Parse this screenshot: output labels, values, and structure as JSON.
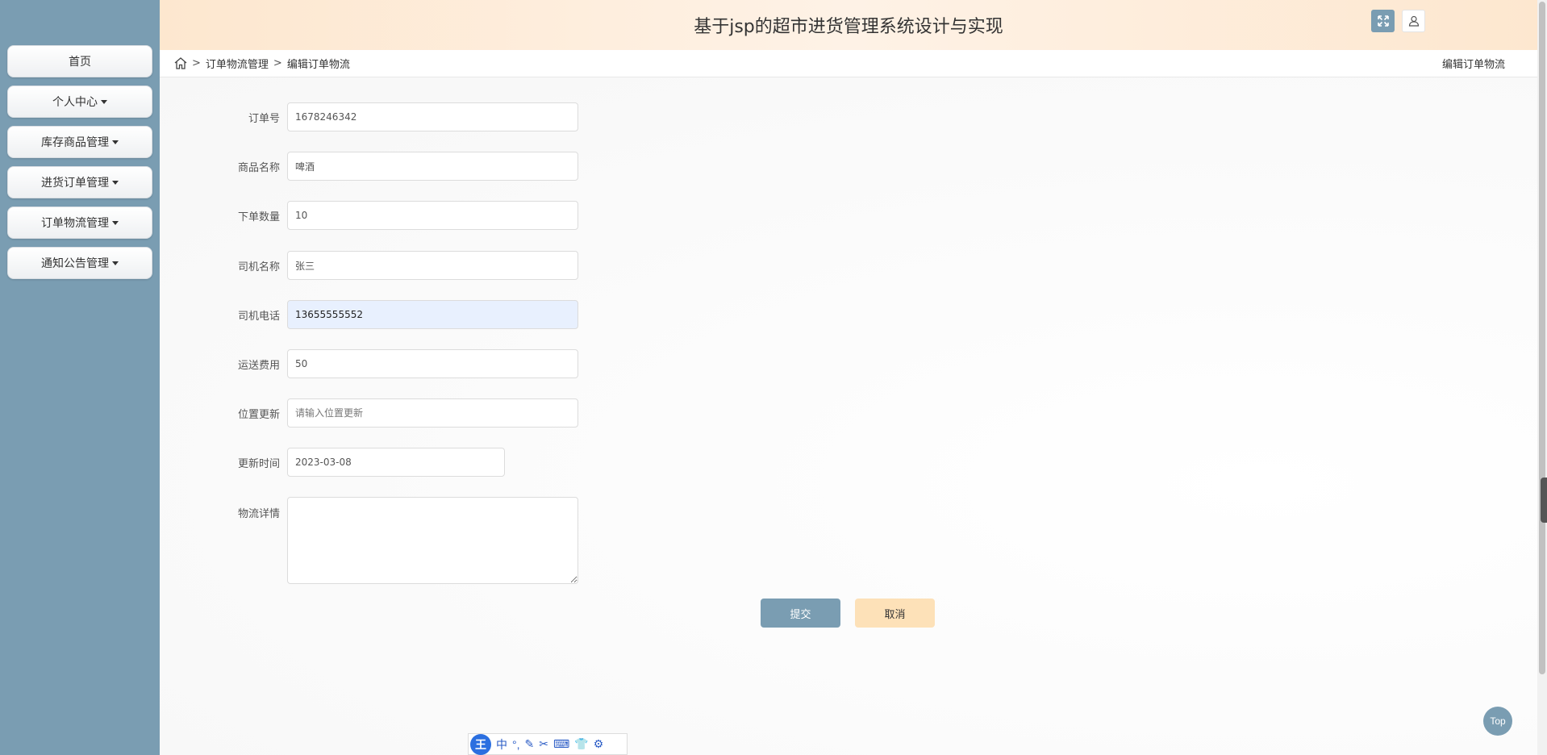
{
  "app": {
    "title": "基于jsp的超市进货管理系统设计与实现"
  },
  "sidebar": {
    "items": [
      {
        "label": "首页",
        "dropdown": false
      },
      {
        "label": "个人中心",
        "dropdown": true
      },
      {
        "label": "库存商品管理",
        "dropdown": true
      },
      {
        "label": "进货订单管理",
        "dropdown": true
      },
      {
        "label": "订单物流管理",
        "dropdown": true
      },
      {
        "label": "通知公告管理",
        "dropdown": true
      }
    ]
  },
  "header": {
    "fullscreen_icon": "expand-icon",
    "user_icon": "user-icon"
  },
  "breadcrumb": {
    "home_icon": "home-icon",
    "separator": ">",
    "items": [
      "订单物流管理",
      "编辑订单物流"
    ],
    "page_label": "编辑订单物流"
  },
  "form": {
    "fields": [
      {
        "label": "订单号",
        "value": "1678246342",
        "placeholder": ""
      },
      {
        "label": "商品名称",
        "value": "啤酒",
        "placeholder": ""
      },
      {
        "label": "下单数量",
        "value": "10",
        "placeholder": ""
      },
      {
        "label": "司机名称",
        "value": "张三",
        "placeholder": ""
      },
      {
        "label": "司机电话",
        "value": "13655555552",
        "placeholder": ""
      },
      {
        "label": "运送费用",
        "value": "50",
        "placeholder": ""
      },
      {
        "label": "位置更新",
        "value": "",
        "placeholder": "请输入位置更新"
      },
      {
        "label": "更新时间",
        "value": "2023-03-08",
        "placeholder": ""
      },
      {
        "label": "物流详情",
        "value": "",
        "placeholder": ""
      }
    ],
    "submit_label": "提交",
    "cancel_label": "取消"
  },
  "top_button": {
    "label": "Top"
  },
  "ime_toolbar": {
    "logo": "王",
    "items": [
      "中",
      "°,",
      "✎",
      "✂",
      "⌨",
      "👕",
      "⚙"
    ]
  },
  "colors": {
    "sidebar_bg": "#7a9db2",
    "header_bg": "#fde7cf",
    "submit_bg": "#7a9db2",
    "cancel_bg": "#fde1b8",
    "active_input_bg": "#e8f0fe"
  }
}
